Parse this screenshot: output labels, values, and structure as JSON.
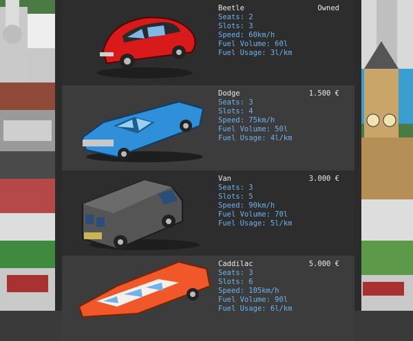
{
  "vehicles": [
    {
      "name": "Beetle",
      "seats": "Seats: 2",
      "slots": "Slots: 3",
      "speed": "Speed: 60km/h",
      "fuel_volume": "Fuel Volume: 60l",
      "fuel_usage": "Fuel Usage: 3l/km",
      "price": "Owned",
      "color": "#d81a1a"
    },
    {
      "name": "Dodge",
      "seats": "Seats: 3",
      "slots": "Slots: 4",
      "speed": "Speed: 75km/h",
      "fuel_volume": "Fuel Volume: 50l",
      "fuel_usage": "Fuel Usage: 4l/km",
      "price": "1.500 €",
      "color": "#2f8fd8"
    },
    {
      "name": "Van",
      "seats": "Seats: 3",
      "slots": "Slots: 5",
      "speed": "Speed: 90km/h",
      "fuel_volume": "Fuel Volume: 70l",
      "fuel_usage": "Fuel Usage: 5l/km",
      "price": "3.000 €",
      "color": "#555555"
    },
    {
      "name": "Caddilac",
      "seats": "Seats: 3",
      "slots": "Slots: 6",
      "speed": "Speed: 105km/h",
      "fuel_volume": "Fuel Volume: 90l",
      "fuel_usage": "Fuel Usage: 6l/km",
      "price": "5.000 €",
      "color": "#f0582a"
    }
  ]
}
